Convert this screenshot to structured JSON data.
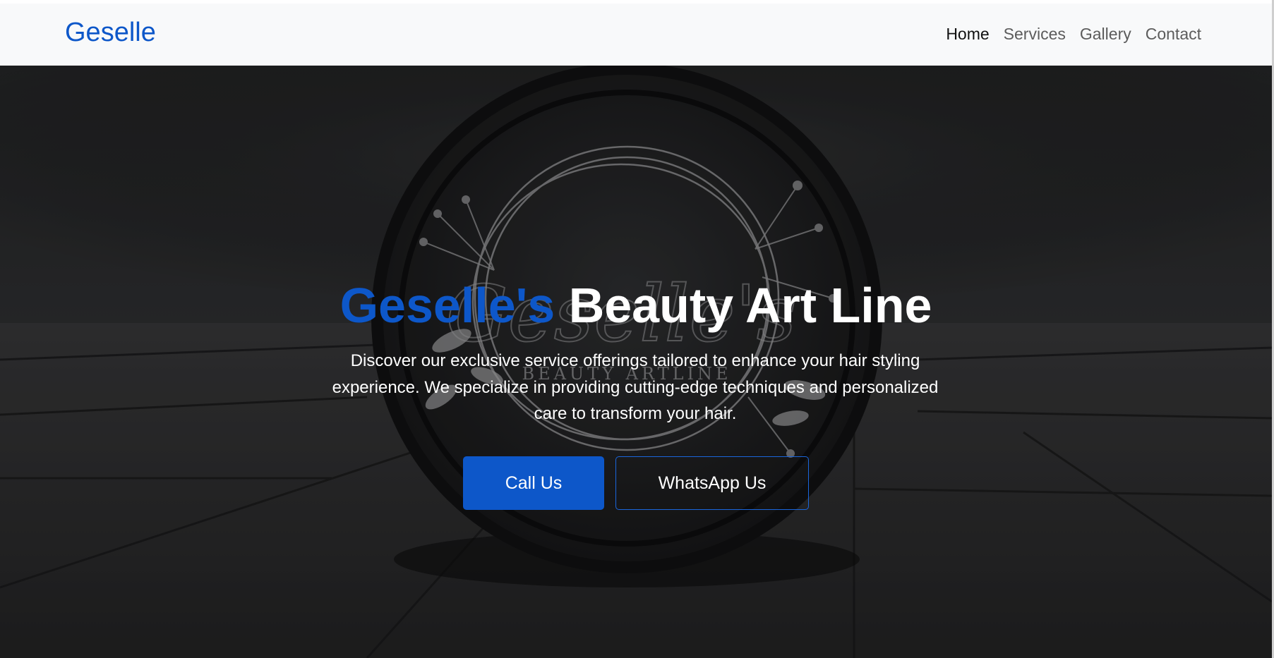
{
  "navbar": {
    "brand": "Geselle",
    "links": [
      "Home",
      "Services",
      "Gallery",
      "Contact"
    ],
    "active_link": "Home"
  },
  "hero": {
    "title_accent": "Geselle's",
    "title_rest": "Beauty Art Line",
    "subtitle_lines": [
      "Discover our exclusive service offerings tailored to enhance your hair styling",
      "experience. We specialize in providing cutting-edge techniques and personalized",
      "care to transform your hair."
    ],
    "buttons": {
      "call": "Call Us",
      "whatsapp": "WhatsApp Us"
    },
    "logo_script": "Geselle's",
    "logo_caption": "BEAUTY ARTLINE"
  },
  "colors": {
    "brand": "#0d57c9",
    "navbar_bg": "#f8f9fa",
    "hero_text": "#ffffff",
    "button_border": "#1a66dd"
  }
}
